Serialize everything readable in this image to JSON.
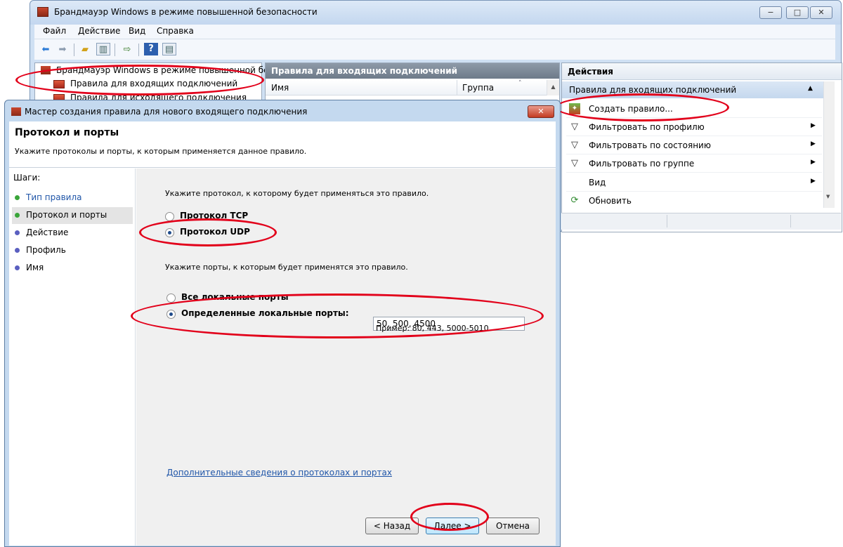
{
  "main_window": {
    "title": "Брандмауэр Windows в режиме повышенной безопасности",
    "menu": [
      "Файл",
      "Действие",
      "Вид",
      "Справка"
    ],
    "window_buttons": [
      "−",
      "□",
      "✕"
    ]
  },
  "tree": {
    "root": "Брандмауэр Windows в режиме повышенной бе",
    "item_inbound": "Правила для входящих подключений",
    "item_outbound": "Правила для исходящего подключения"
  },
  "list": {
    "header": "Правила для входящих подключений",
    "col_name": "Имя",
    "col_group": "Группа"
  },
  "actions": {
    "title": "Действия",
    "group": "Правила для входящих подключений",
    "items": [
      {
        "label": "Создать правило...",
        "icon": "new-rule-icon",
        "arrow": ""
      },
      {
        "label": "Фильтровать по профилю",
        "icon": "filter-icon",
        "arrow": "▶"
      },
      {
        "label": "Фильтровать по состоянию",
        "icon": "filter-icon",
        "arrow": "▶"
      },
      {
        "label": "Фильтровать по группе",
        "icon": "filter-icon",
        "arrow": "▶"
      },
      {
        "label": "Вид",
        "icon": "",
        "arrow": "▶"
      },
      {
        "label": "Обновить",
        "icon": "refresh-icon",
        "arrow": ""
      }
    ]
  },
  "dialog": {
    "title": "Мастер создания правила для нового входящего подключения",
    "close_label": "✕",
    "heading": "Протокол и порты",
    "subheading": "Укажите протоколы и порты, к которым применяется данное правило.",
    "steps_title": "Шаги:",
    "steps": [
      {
        "label": "Тип правила",
        "state": "done"
      },
      {
        "label": "Протокол и порты",
        "state": "current"
      },
      {
        "label": "Действие",
        "state": "pending"
      },
      {
        "label": "Профиль",
        "state": "pending"
      },
      {
        "label": "Имя",
        "state": "pending"
      }
    ],
    "protocol_prompt": "Укажите протокол, к которому будет применяться это правило.",
    "protocol_tcp": "Протокол TCP",
    "protocol_udp": "Протокол UDP",
    "protocol_selected": "UDP",
    "ports_prompt": "Укажите порты, к которым будет применятся это правило.",
    "ports_all": "Все локальные порты",
    "ports_specific": "Определенные локальные порты:",
    "ports_selected": "specific",
    "ports_value": "50, 500, 4500",
    "ports_example": "Пример: 80, 443, 5000-5010",
    "more_info_link": "Дополнительные сведения о протоколах и портах",
    "back_button": "< Назад",
    "next_button": "Далее >",
    "cancel_button": "Отмена"
  },
  "colors": {
    "highlight_ellipse": "#e2001a",
    "step_done": "#3aa53a",
    "step_pending": "#5a5fc0",
    "link": "#1f55a8"
  }
}
